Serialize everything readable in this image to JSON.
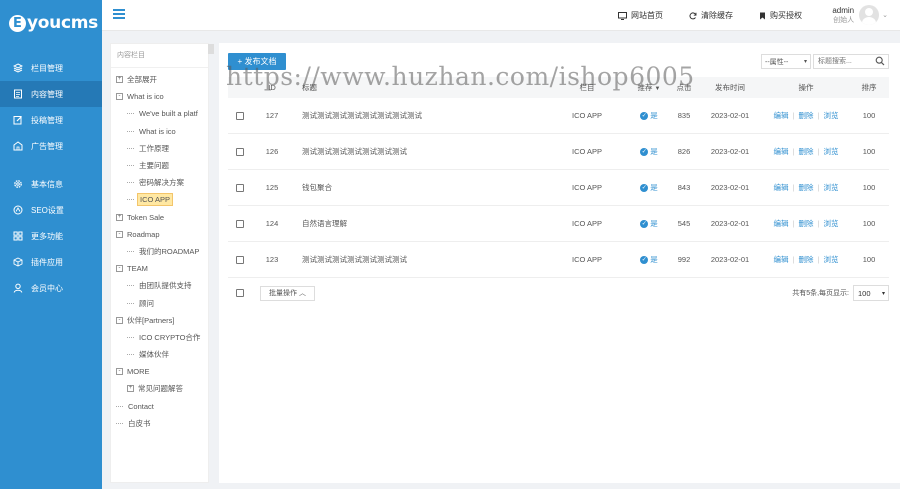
{
  "brand": {
    "mark": "E",
    "name": "youcms"
  },
  "sidebar": {
    "items": [
      {
        "label": "栏目管理",
        "icon": "layers-icon",
        "active": false
      },
      {
        "label": "内容管理",
        "icon": "document-icon",
        "active": true
      },
      {
        "label": "投稿管理",
        "icon": "edit-icon",
        "active": false
      },
      {
        "label": "广告管理",
        "icon": "ad-icon",
        "active": false
      },
      {
        "label": "基本信息",
        "icon": "gear-icon",
        "active": false
      },
      {
        "label": "SEO设置",
        "icon": "seo-icon",
        "active": false
      },
      {
        "label": "更多功能",
        "icon": "grid-icon",
        "active": false
      },
      {
        "label": "插件应用",
        "icon": "cube-icon",
        "active": false
      },
      {
        "label": "会员中心",
        "icon": "user-icon",
        "active": false
      }
    ]
  },
  "topbar": {
    "links": [
      {
        "label": "网站首页",
        "icon": "monitor-icon"
      },
      {
        "label": "清除缓存",
        "icon": "refresh-icon"
      },
      {
        "label": "购买授权",
        "icon": "bookmark-icon"
      }
    ],
    "user": {
      "name": "admin",
      "role": "创始人"
    }
  },
  "tree": {
    "header": "内容栏目",
    "nodes": [
      {
        "label": "全部展开",
        "level": 0,
        "toggle": "+"
      },
      {
        "label": "What is ico",
        "level": 0,
        "toggle": "-"
      },
      {
        "label": "We've built a platf",
        "level": 1
      },
      {
        "label": "What is ico",
        "level": 1
      },
      {
        "label": "工作原理",
        "level": 1
      },
      {
        "label": "主要问题",
        "level": 1
      },
      {
        "label": "密码解决方案",
        "level": 1
      },
      {
        "label": "ICO APP",
        "level": 1,
        "selected": true
      },
      {
        "label": "Token Sale",
        "level": 0,
        "toggle": "+"
      },
      {
        "label": "Roadmap",
        "level": 0,
        "toggle": "-"
      },
      {
        "label": "我们的ROADMAP",
        "level": 1
      },
      {
        "label": "TEAM",
        "level": 0,
        "toggle": "-"
      },
      {
        "label": "由团队提供支持",
        "level": 1
      },
      {
        "label": "顾问",
        "level": 1
      },
      {
        "label": "伙伴[Partners]",
        "level": 0,
        "toggle": "-"
      },
      {
        "label": "ICO CRYPTO合作",
        "level": 1
      },
      {
        "label": "媒体伙伴",
        "level": 1
      },
      {
        "label": "MORE",
        "level": 0,
        "toggle": "-"
      },
      {
        "label": "常见问题解答",
        "level": 1,
        "toggle": "+"
      },
      {
        "label": "Contact",
        "level": 0
      },
      {
        "label": "白皮书",
        "level": 0
      }
    ]
  },
  "toolbar": {
    "publish_label": "+ 发布文档",
    "filter_value": "--属性--",
    "search_placeholder": "标题搜索..."
  },
  "table": {
    "headers": {
      "id": "ID",
      "title": "标题",
      "column": "栏目",
      "recommend": "推荐",
      "clicks": "点击",
      "date": "发布时间",
      "ops": "操作",
      "sort": "排序"
    },
    "rows": [
      {
        "id": "127",
        "title": "测试测试测试测试测试测试测试测试",
        "column": "ICO APP",
        "rec": "是",
        "clicks": "835",
        "date": "2023-02-01",
        "sort": "100"
      },
      {
        "id": "126",
        "title": "测试测试测试测试测试测试测试",
        "column": "ICO APP",
        "rec": "是",
        "clicks": "826",
        "date": "2023-02-01",
        "sort": "100"
      },
      {
        "id": "125",
        "title": "钱包聚合",
        "column": "ICO APP",
        "rec": "是",
        "clicks": "843",
        "date": "2023-02-01",
        "sort": "100"
      },
      {
        "id": "124",
        "title": "自然语言理解",
        "column": "ICO APP",
        "rec": "是",
        "clicks": "545",
        "date": "2023-02-01",
        "sort": "100"
      },
      {
        "id": "123",
        "title": "测试测试测试测试测试测试测试",
        "column": "ICO APP",
        "rec": "是",
        "clicks": "992",
        "date": "2023-02-01",
        "sort": "100"
      }
    ],
    "ops": {
      "edit": "编辑",
      "delete": "删除",
      "view": "浏览"
    }
  },
  "footer": {
    "batch_label": "批量操作",
    "pager_text": "共有5条,每页显示:",
    "page_size": "100"
  },
  "watermark": "https://www.huzhan.com/ishop6005",
  "colors": {
    "primary": "#2f8fd0",
    "sidebar_active": "#2579b6"
  }
}
